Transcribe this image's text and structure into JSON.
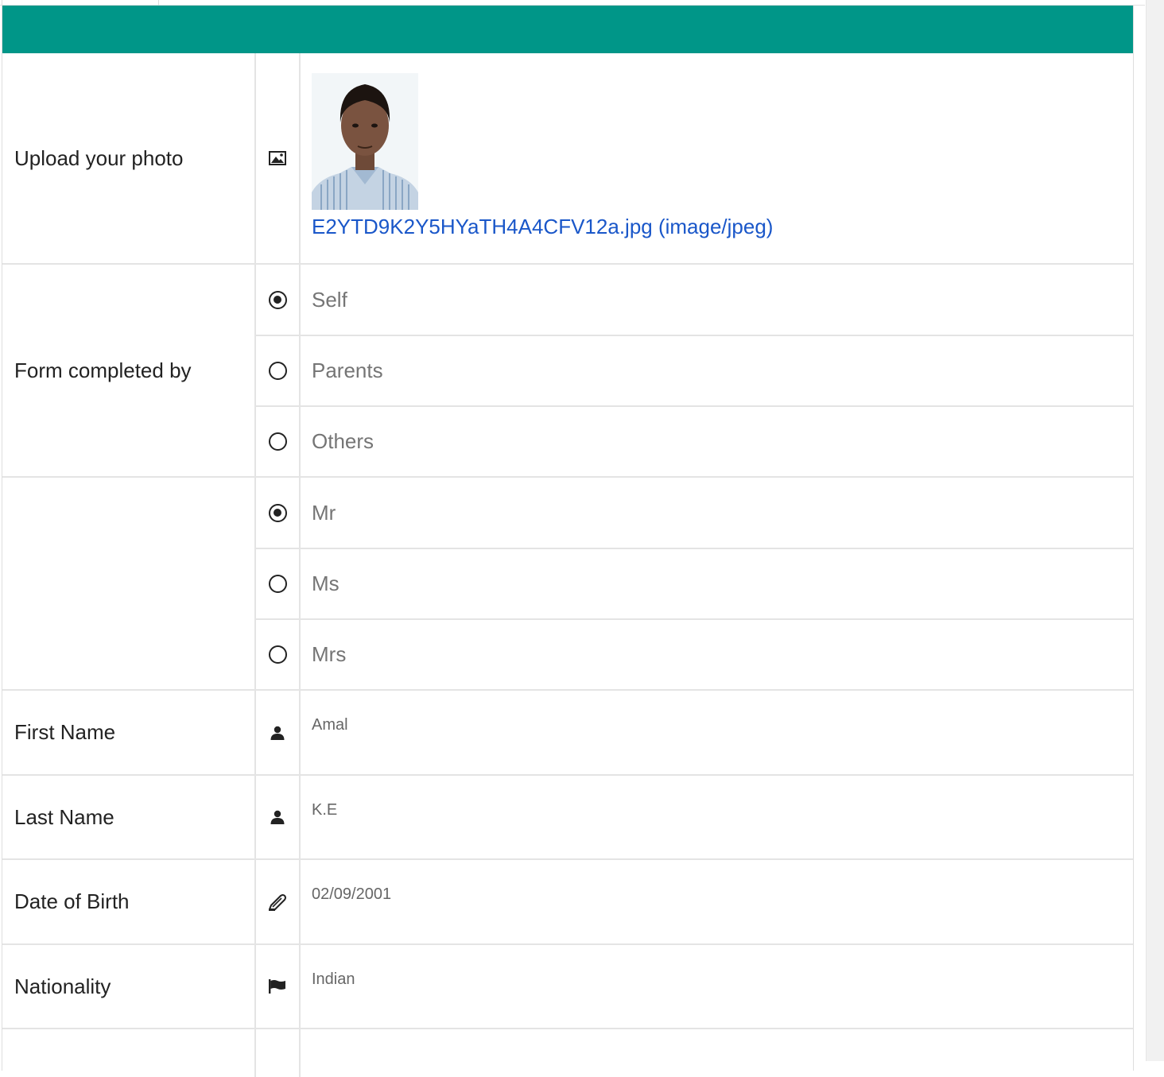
{
  "photo_row": {
    "label": "Upload your photo",
    "icon": "image-icon",
    "file_link": "E2YTD9K2Y5HYaTH4A4CFV12a.jpg (image/jpeg)"
  },
  "form_completed_by": {
    "label": "Form completed by",
    "options": [
      {
        "label": "Self",
        "selected": true
      },
      {
        "label": "Parents",
        "selected": false
      },
      {
        "label": "Others",
        "selected": false
      }
    ]
  },
  "title": {
    "label": "",
    "options": [
      {
        "label": "Mr",
        "selected": true
      },
      {
        "label": "Ms",
        "selected": false
      },
      {
        "label": "Mrs",
        "selected": false
      }
    ]
  },
  "fields": {
    "first_name": {
      "label": "First Name",
      "value": "Amal",
      "icon": "user-icon"
    },
    "last_name": {
      "label": "Last Name",
      "value": "K.E",
      "icon": "user-icon"
    },
    "dob": {
      "label": "Date of Birth",
      "value": "02/09/2001",
      "icon": "pen-icon"
    },
    "nationality": {
      "label": "Nationality",
      "value": "Indian",
      "icon": "flag-icon"
    }
  },
  "colors": {
    "header": "#009688",
    "link": "#1a57c9"
  }
}
